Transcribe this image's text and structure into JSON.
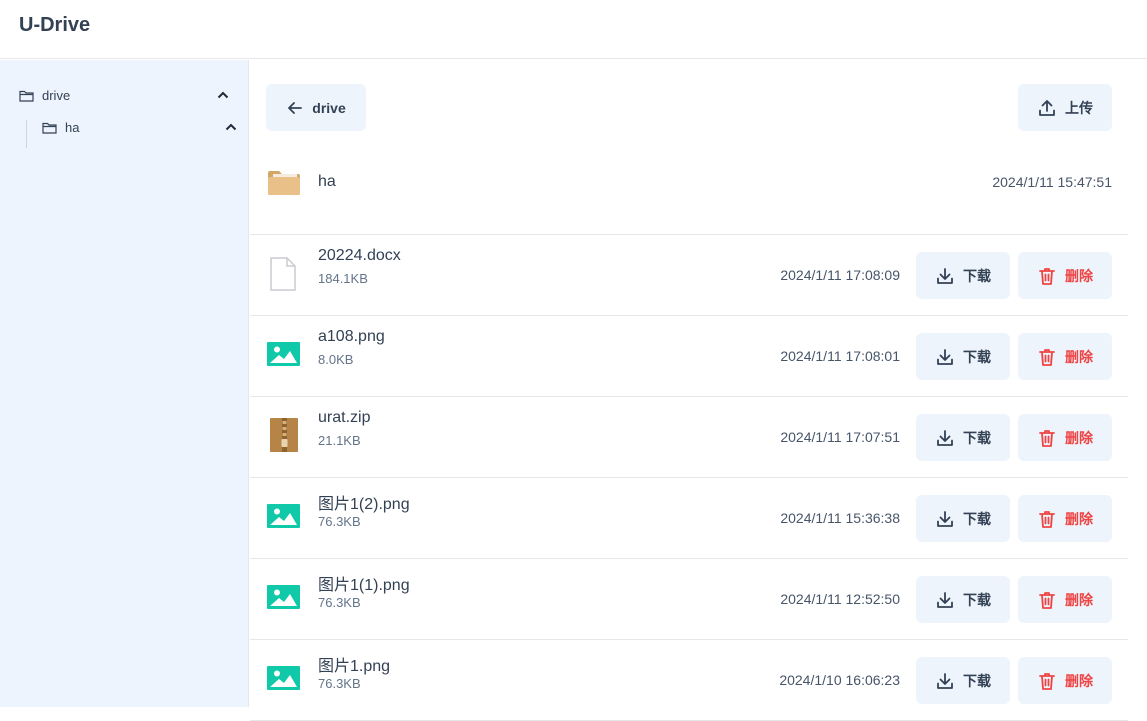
{
  "app": {
    "title": "U-Drive"
  },
  "sidebar": {
    "tree": [
      {
        "label": "drive",
        "icon": "folder-outline-icon",
        "expanded": true
      },
      {
        "label": "ha",
        "icon": "folder-outline-icon",
        "expanded": true
      }
    ]
  },
  "toolbar": {
    "back_label": "drive",
    "upload_label": "上传"
  },
  "folders": [
    {
      "name": "ha",
      "time": "2024/1/11 15:47:51",
      "icon": "folder-icon"
    }
  ],
  "files": [
    {
      "name": "20224.docx",
      "size": "184.1KB",
      "time": "2024/1/11 17:08:09",
      "icon": "document-icon"
    },
    {
      "name": "a108.png",
      "size": "8.0KB",
      "time": "2024/1/11 17:08:01",
      "icon": "image-icon"
    },
    {
      "name": "urat.zip",
      "size": "21.1KB",
      "time": "2024/1/11 17:07:51",
      "icon": "archive-icon"
    },
    {
      "name": "图片1(2).png",
      "size": "76.3KB",
      "time": "2024/1/11 15:36:38",
      "icon": "image-icon"
    },
    {
      "name": "图片1(1).png",
      "size": "76.3KB",
      "time": "2024/1/11 12:52:50",
      "icon": "image-icon"
    },
    {
      "name": "图片1.png",
      "size": "76.3KB",
      "time": "2024/1/10 16:06:23",
      "icon": "image-icon"
    }
  ],
  "actions": {
    "download_label": "下载",
    "delete_label": "删除"
  },
  "colors": {
    "accent": "#eef4fb",
    "danger": "#ef4444",
    "image": "#10c9a8",
    "folder": "#e0b87a"
  }
}
